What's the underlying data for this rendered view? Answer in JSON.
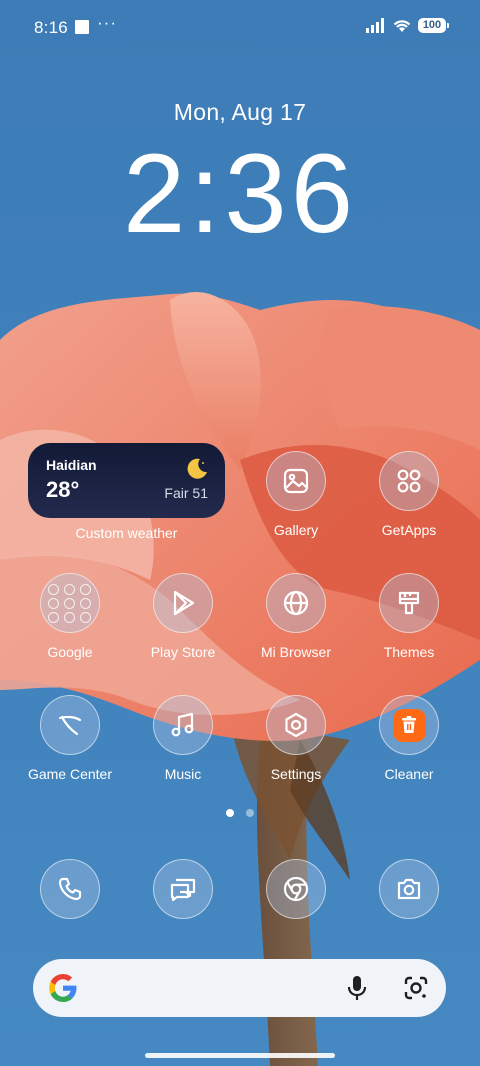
{
  "status_bar": {
    "time": "8:16",
    "overflow": "···",
    "battery": "100"
  },
  "lock": {
    "date": "Mon, Aug 17",
    "time": "2:36"
  },
  "weather": {
    "city": "Haidian",
    "temperature": "28°",
    "condition": "Fair 51",
    "icon": "moon-icon",
    "label": "Custom weather"
  },
  "apps": {
    "gallery": "Gallery",
    "getapps": "GetApps",
    "google": "Google",
    "play_store": "Play Store",
    "mi_browser": "Mi Browser",
    "themes": "Themes",
    "game_center": "Game Center",
    "music": "Music",
    "settings": "Settings",
    "cleaner": "Cleaner"
  },
  "pager": {
    "current_page": 1,
    "total_pages": 2
  },
  "dock": [
    "phone-icon",
    "messages-icon",
    "chrome-icon",
    "camera-icon"
  ],
  "colors": {
    "sky": "#3f7fb8",
    "cleaner_accent": "#ff6a16",
    "widget_bg": "#121a36",
    "moon": "#f4c542"
  }
}
